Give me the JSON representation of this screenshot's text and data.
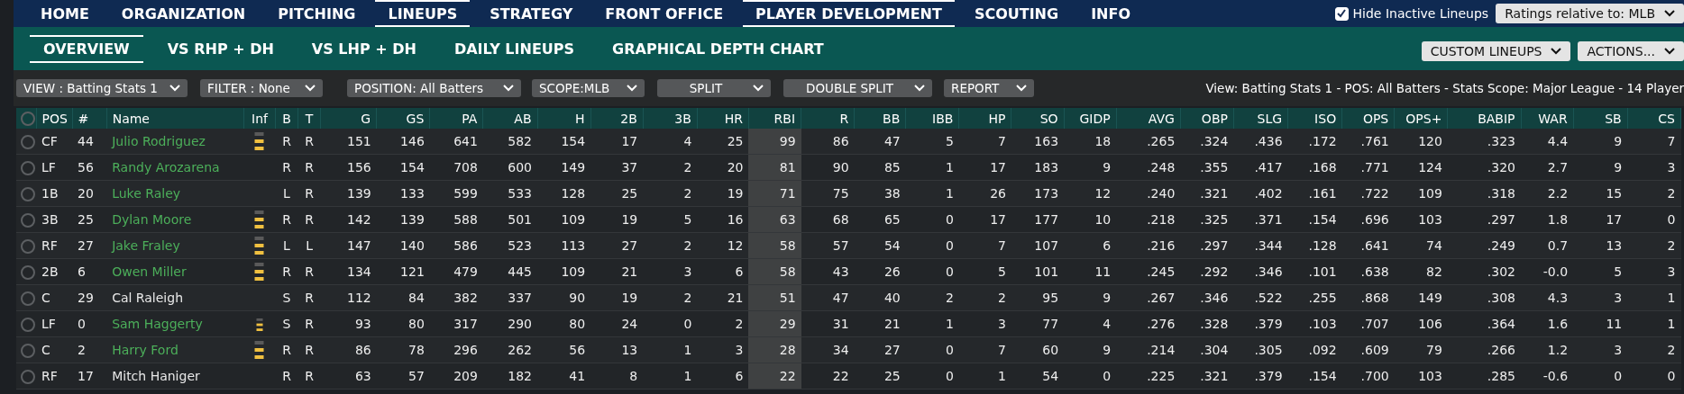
{
  "top_nav": [
    {
      "label": "HOME",
      "selected": false
    },
    {
      "label": "ORGANIZATION",
      "selected": false
    },
    {
      "label": "PITCHING",
      "selected": false
    },
    {
      "label": "LINEUPS",
      "selected": true
    },
    {
      "label": "STRATEGY",
      "selected": false
    },
    {
      "label": "FRONT OFFICE",
      "selected": false
    },
    {
      "label": "PLAYER DEVELOPMENT",
      "selected": true
    },
    {
      "label": "SCOUTING",
      "selected": false
    },
    {
      "label": "INFO",
      "selected": false
    }
  ],
  "hide_inactive": {
    "label": "Hide Inactive Lineups",
    "checked": true
  },
  "ratings_dropdown": "Ratings relative to: MLB",
  "sub_nav": [
    {
      "label": "OVERVIEW",
      "selected": true
    },
    {
      "label": "VS RHP + DH",
      "selected": false
    },
    {
      "label": "VS LHP + DH",
      "selected": false
    },
    {
      "label": "DAILY LINEUPS",
      "selected": false
    },
    {
      "label": "GRAPHICAL DEPTH CHART",
      "selected": false
    }
  ],
  "sub_actions": [
    "CUSTOM LINEUPS",
    "ACTIONS..."
  ],
  "filters": [
    {
      "label": "VIEW : Batting Stats 1",
      "kind": "left"
    },
    {
      "label": "FILTER : None",
      "kind": "left"
    },
    {
      "label": "POSITION: All Batters",
      "kind": "left"
    },
    {
      "label": "SCOPE:MLB",
      "kind": "left"
    },
    {
      "label": "SPLIT",
      "kind": "center"
    },
    {
      "label": "DOUBLE SPLIT",
      "kind": "center"
    },
    {
      "label": "REPORT",
      "kind": "left"
    }
  ],
  "summary": "View: Batting Stats 1 - POS: All Batters - Stats Scope: Major League - 14 Player",
  "table": {
    "select_all": {
      "selected": false
    },
    "columns": [
      {
        "label": "POS",
        "sorted": false
      },
      {
        "label": "#",
        "sorted": false
      },
      {
        "label": "Name",
        "sorted": false
      },
      {
        "label": "Inf",
        "sorted": false
      },
      {
        "label": "B",
        "sorted": false
      },
      {
        "label": "T",
        "sorted": false
      },
      {
        "label": "G",
        "sorted": false
      },
      {
        "label": "GS",
        "sorted": false
      },
      {
        "label": "PA",
        "sorted": false
      },
      {
        "label": "AB",
        "sorted": false
      },
      {
        "label": "H",
        "sorted": false
      },
      {
        "label": "2B",
        "sorted": false
      },
      {
        "label": "3B",
        "sorted": false
      },
      {
        "label": "HR",
        "sorted": false
      },
      {
        "label": "RBI",
        "sorted": true
      },
      {
        "label": "R",
        "sorted": false
      },
      {
        "label": "BB",
        "sorted": false
      },
      {
        "label": "IBB",
        "sorted": false
      },
      {
        "label": "HP",
        "sorted": false
      },
      {
        "label": "SO",
        "sorted": false
      },
      {
        "label": "GIDP",
        "sorted": false
      },
      {
        "label": "AVG",
        "sorted": false
      },
      {
        "label": "OBP",
        "sorted": false
      },
      {
        "label": "SLG",
        "sorted": false
      },
      {
        "label": "ISO",
        "sorted": false
      },
      {
        "label": "OPS",
        "sorted": false
      },
      {
        "label": "OPS+",
        "sorted": false
      },
      {
        "label": "BABIP",
        "sorted": false
      },
      {
        "label": "WAR",
        "sorted": false
      },
      {
        "label": "SB",
        "sorted": false
      },
      {
        "label": "CS",
        "sorted": false
      }
    ],
    "rows": [
      {
        "selected": false,
        "color": "#4caf5a",
        "kind": "bars",
        "cells": [
          "CF",
          "44",
          "Julio Rodriguez",
          "",
          "R",
          "R",
          "151",
          "146",
          "641",
          "582",
          "154",
          "17",
          "4",
          "25",
          "99",
          "86",
          "47",
          "5",
          "7",
          "163",
          "18",
          ".265",
          ".324",
          ".436",
          ".172",
          ".761",
          "120",
          ".323",
          "4.4",
          "9",
          "7"
        ]
      },
      {
        "selected": false,
        "color": "#4caf5a",
        "kind": "plain",
        "cells": [
          "LF",
          "56",
          "Randy Arozarena",
          "",
          "R",
          "R",
          "156",
          "154",
          "708",
          "600",
          "149",
          "37",
          "2",
          "20",
          "81",
          "90",
          "85",
          "1",
          "17",
          "183",
          "9",
          ".248",
          ".355",
          ".417",
          ".168",
          ".771",
          "124",
          ".320",
          "2.7",
          "9",
          "3"
        ]
      },
      {
        "selected": false,
        "color": "#4caf5a",
        "kind": "plain",
        "cells": [
          "1B",
          "20",
          "Luke Raley",
          "",
          "L",
          "R",
          "139",
          "133",
          "599",
          "533",
          "128",
          "25",
          "2",
          "19",
          "71",
          "75",
          "38",
          "1",
          "26",
          "173",
          "12",
          ".240",
          ".321",
          ".402",
          ".161",
          ".722",
          "109",
          ".318",
          "2.2",
          "15",
          "2"
        ]
      },
      {
        "selected": false,
        "color": "#4caf5a",
        "kind": "bars",
        "cells": [
          "3B",
          "25",
          "Dylan Moore",
          "",
          "R",
          "R",
          "142",
          "139",
          "588",
          "501",
          "109",
          "19",
          "5",
          "16",
          "63",
          "68",
          "65",
          "0",
          "17",
          "177",
          "10",
          ".218",
          ".325",
          ".371",
          ".154",
          ".696",
          "103",
          ".297",
          "1.8",
          "17",
          "0"
        ]
      },
      {
        "selected": false,
        "color": "#4caf5a",
        "kind": "bars",
        "cells": [
          "RF",
          "27",
          "Jake Fraley",
          "",
          "L",
          "L",
          "147",
          "140",
          "586",
          "523",
          "113",
          "27",
          "2",
          "12",
          "58",
          "57",
          "54",
          "0",
          "7",
          "107",
          "6",
          ".216",
          ".297",
          ".344",
          ".128",
          ".641",
          "74",
          ".249",
          "0.7",
          "13",
          "2"
        ]
      },
      {
        "selected": false,
        "color": "#4caf5a",
        "kind": "bars",
        "cells": [
          "2B",
          "6",
          "Owen Miller",
          "",
          "R",
          "R",
          "134",
          "121",
          "479",
          "445",
          "109",
          "21",
          "3",
          "6",
          "58",
          "43",
          "26",
          "0",
          "5",
          "101",
          "11",
          ".245",
          ".292",
          ".346",
          ".101",
          ".638",
          "82",
          ".302",
          "-0.0",
          "5",
          "3"
        ]
      },
      {
        "selected": false,
        "color": "#e8e8e8",
        "kind": "plain",
        "cells": [
          "C",
          "29",
          "Cal Raleigh",
          "",
          "S",
          "R",
          "112",
          "84",
          "382",
          "337",
          "90",
          "19",
          "2",
          "21",
          "51",
          "47",
          "40",
          "2",
          "2",
          "95",
          "9",
          ".267",
          ".346",
          ".522",
          ".255",
          ".868",
          "149",
          ".308",
          "4.3",
          "3",
          "1"
        ]
      },
      {
        "selected": false,
        "color": "#4caf5a",
        "kind": "small",
        "cells": [
          "LF",
          "0",
          "Sam Haggerty",
          "",
          "S",
          "R",
          "93",
          "80",
          "317",
          "290",
          "80",
          "24",
          "0",
          "2",
          "29",
          "31",
          "21",
          "1",
          "3",
          "77",
          "4",
          ".276",
          ".328",
          ".379",
          ".103",
          ".707",
          "106",
          ".364",
          "1.6",
          "11",
          "1"
        ]
      },
      {
        "selected": false,
        "color": "#4caf5a",
        "kind": "bars",
        "cells": [
          "C",
          "2",
          "Harry Ford",
          "",
          "R",
          "R",
          "86",
          "78",
          "296",
          "262",
          "56",
          "13",
          "1",
          "3",
          "28",
          "34",
          "27",
          "0",
          "7",
          "60",
          "9",
          ".214",
          ".304",
          ".305",
          ".092",
          ".609",
          "79",
          ".266",
          "1.2",
          "3",
          "2"
        ]
      },
      {
        "selected": false,
        "color": "#e8e8e8",
        "kind": "plain",
        "cells": [
          "RF",
          "17",
          "Mitch Haniger",
          "",
          "R",
          "R",
          "63",
          "57",
          "209",
          "182",
          "41",
          "8",
          "1",
          "6",
          "22",
          "22",
          "25",
          "0",
          "1",
          "54",
          "0",
          ".225",
          ".321",
          ".379",
          ".154",
          ".700",
          "103",
          ".285",
          "-0.6",
          "0",
          "0"
        ]
      }
    ]
  }
}
